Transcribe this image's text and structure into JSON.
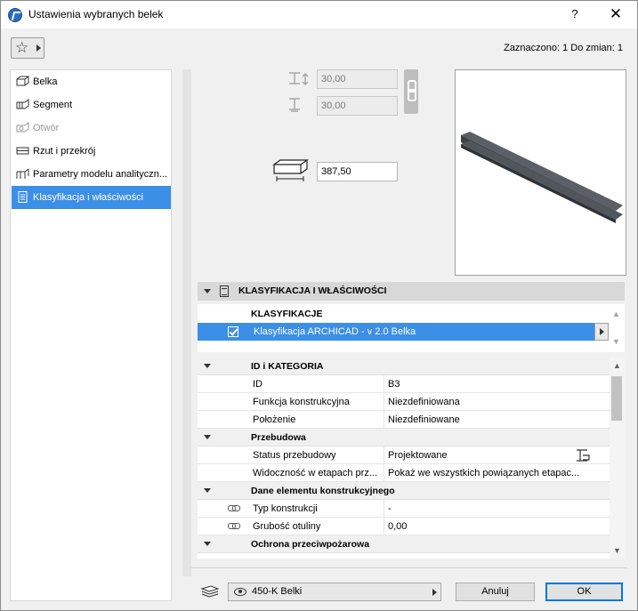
{
  "window": {
    "title": "Ustawienia wybranych belek",
    "help_label": "?",
    "close_label": "✕"
  },
  "toolbar": {
    "favorites_icon": "star-icon",
    "selection_info": "Zaznaczono: 1 Do zmian: 1"
  },
  "sidebar": {
    "items": [
      {
        "label": "Belka",
        "icon": "beam-icon",
        "state": "normal"
      },
      {
        "label": "Segment",
        "icon": "segment-icon",
        "state": "normal"
      },
      {
        "label": "Otwór",
        "icon": "opening-icon",
        "state": "disabled"
      },
      {
        "label": "Rzut i przekrój",
        "icon": "floor-plan-icon",
        "state": "normal"
      },
      {
        "label": "Parametry modelu analityczn...",
        "icon": "analytical-model-icon",
        "state": "normal"
      },
      {
        "label": "Klasyfikacja i właściwości",
        "icon": "classification-icon",
        "state": "active"
      }
    ]
  },
  "geometry": {
    "offset_top": "30,00",
    "offset_bottom": "30,00",
    "length": "387,50"
  },
  "section": {
    "title": "KLASYFIKACJA I WŁAŚCIWOŚCI"
  },
  "classifications": {
    "title": "KLASYFIKACJE",
    "selected_item": "Klasyfikacja ARCHICAD - v 2.0 Belka"
  },
  "properties": {
    "groups": [
      {
        "label": "ID i KATEGORIA"
      },
      {
        "label": "Przebudowa"
      },
      {
        "label": "Dane elementu konstrukcyjnego"
      },
      {
        "label": "Ochrona przeciwpożarowa"
      }
    ],
    "rows": [
      {
        "name": "ID",
        "value": "B3"
      },
      {
        "name": "Funkcja konstrukcyjna",
        "value": "Niezdefiniowana"
      },
      {
        "name": "Położenie",
        "value": "Niezdefiniowane"
      },
      {
        "name": "Status przebudowy",
        "value": "Projektowane"
      },
      {
        "name": "Widoczność w etapach prz...",
        "value": "Pokaż we wszystkich powiązanych etapac..."
      },
      {
        "name": "Typ konstrukcji",
        "value": "-"
      },
      {
        "name": "Grubość otuliny",
        "value": "0,00"
      }
    ]
  },
  "footer": {
    "layer": "450-K Belki",
    "cancel_label": "Anuluj",
    "ok_label": "OK"
  },
  "colors": {
    "accent": "#3c8fe6",
    "beam": "#4a5055"
  }
}
